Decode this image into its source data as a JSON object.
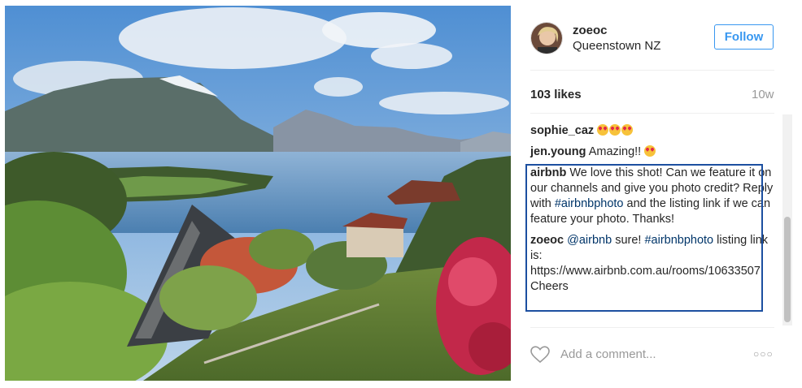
{
  "post": {
    "username": "zoeoc",
    "location": "Queenstown NZ",
    "follow_label": "Follow",
    "likes": "103 likes",
    "age": "10w"
  },
  "comments": [
    {
      "user": "sophie_caz",
      "text": "",
      "emoji_count": 3
    },
    {
      "user": "jen.young",
      "text": "Amazing!!",
      "emoji_count": 1
    },
    {
      "user": "airbnb",
      "text_before": "We love this shot! Can we feature it on our channels and give you photo credit? Reply with",
      "hashtag": "#airbnbphoto",
      "text_after": "and the listing link if we can feature your photo. Thanks!"
    },
    {
      "user": "zoeoc",
      "mention": "@airbnb",
      "text_mid": "sure!",
      "hashtag": "#airbnbphoto",
      "text_after": "listing link is: https://www.airbnb.com.au/rooms/10633507 Cheers"
    }
  ],
  "comment_input": {
    "placeholder": "Add a comment..."
  },
  "more_label": "○○○",
  "icons": {
    "like": "heart-icon",
    "more": "more-options-icon"
  },
  "colors": {
    "accent": "#3897f0",
    "highlight_border": "#1c4fa0",
    "hashtag": "#003569"
  }
}
